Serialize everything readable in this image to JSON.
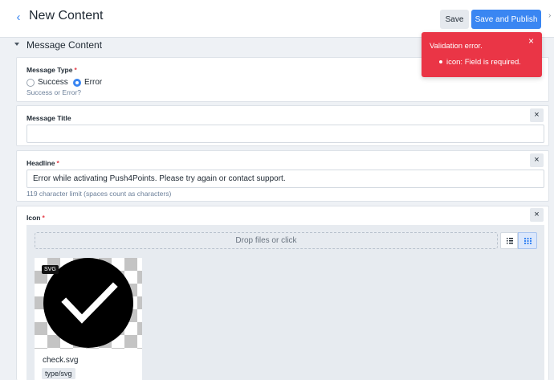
{
  "header": {
    "back_icon": "chevron-left-icon",
    "title": "New Content",
    "save_label": "Save",
    "publish_label": "Save and Publish",
    "colors": {
      "primary": "#3a86f2",
      "save_bg": "#e5e9ee"
    }
  },
  "section": {
    "title": "Message Content"
  },
  "message_type": {
    "label": "Message Type",
    "required_mark": "*",
    "options": [
      {
        "label": "Success",
        "checked": false
      },
      {
        "label": "Error",
        "checked": true
      }
    ],
    "hint": "Success or Error?"
  },
  "message_title": {
    "label": "Message Title",
    "value": "",
    "close_glyph": "×"
  },
  "headline": {
    "label": "Headline",
    "required_mark": "*",
    "value": "Error while activating Push4Points. Please try again or contact support.",
    "hint": "119 character limit (spaces count as characters)",
    "close_glyph": "×"
  },
  "icon_field": {
    "label": "Icon",
    "required_mark": "*",
    "drop_text": "Drop files or click",
    "close_glyph": "×",
    "view_modes": [
      "list-view-icon",
      "grid-view-icon"
    ],
    "active_view": "grid",
    "file": {
      "badge": "SVG",
      "name": "check.svg",
      "type": "type/svg"
    }
  },
  "toast": {
    "title": "Validation error.",
    "errors": [
      "icon: Field is required."
    ],
    "close_glyph": "×",
    "color": "#ea3546"
  }
}
